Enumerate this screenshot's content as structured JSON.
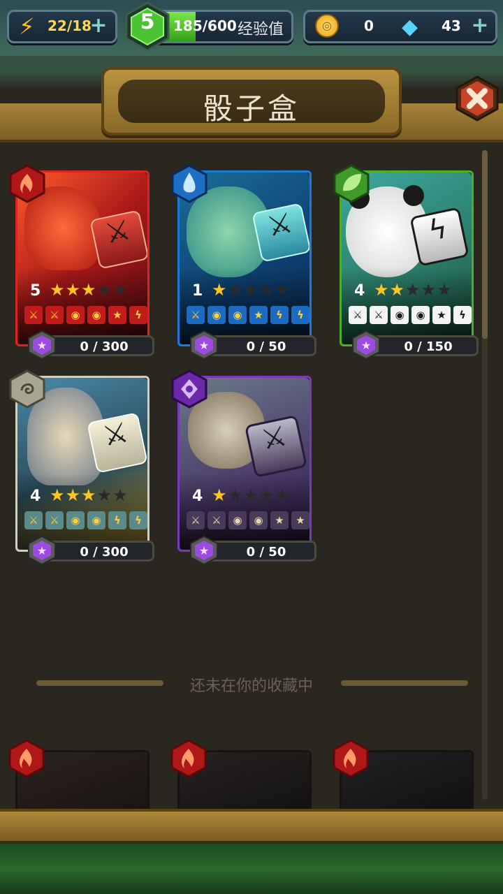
{
  "topbar": {
    "energy": "22/18",
    "level": "5",
    "xp_value": "185/600",
    "xp_label": "经验值",
    "xp_progress": 0.31,
    "gold": "0",
    "gems": "43",
    "energy_icon": "lightning-icon",
    "gold_icon": "coin-icon",
    "gem_icon": "diamond-icon"
  },
  "header": {
    "title": "骰子盒"
  },
  "cards": [
    {
      "element": "fire",
      "level": "5",
      "stars": 3,
      "progress": "0 / 300",
      "faces": [
        "sword",
        "sword",
        "shield",
        "shield",
        "star",
        "bolt"
      ],
      "frame": "#c11c1c"
    },
    {
      "element": "water",
      "level": "1",
      "stars": 1,
      "progress": "0 / 50",
      "faces": [
        "sword",
        "shield",
        "shield",
        "star",
        "bolt",
        "bolt"
      ],
      "frame": "#1c6bc1"
    },
    {
      "element": "nature",
      "level": "4",
      "stars": 2,
      "progress": "0 / 150",
      "faces": [
        "sword",
        "sword",
        "shield",
        "shield",
        "star",
        "bolt"
      ],
      "frame": "#4aa72a"
    },
    {
      "element": "wind",
      "level": "4",
      "stars": 3,
      "progress": "0 / 300",
      "faces": [
        "sword",
        "sword",
        "shield",
        "shield",
        "bolt",
        "bolt"
      ],
      "frame": "#c8c8b8"
    },
    {
      "element": "arcane",
      "level": "4",
      "stars": 1,
      "progress": "0 / 50",
      "faces": [
        "sword",
        "sword",
        "shield",
        "shield",
        "star",
        "star"
      ],
      "frame": "#6b3aa3"
    }
  ],
  "section": {
    "not_collected": "还未在你的收藏中"
  },
  "colors": {
    "fire": "#c11c1c",
    "water": "#1c6bc1",
    "nature": "#4aa72a",
    "wind": "#bdbdae",
    "arcane": "#6b3aa3",
    "star": "#ffc524"
  }
}
